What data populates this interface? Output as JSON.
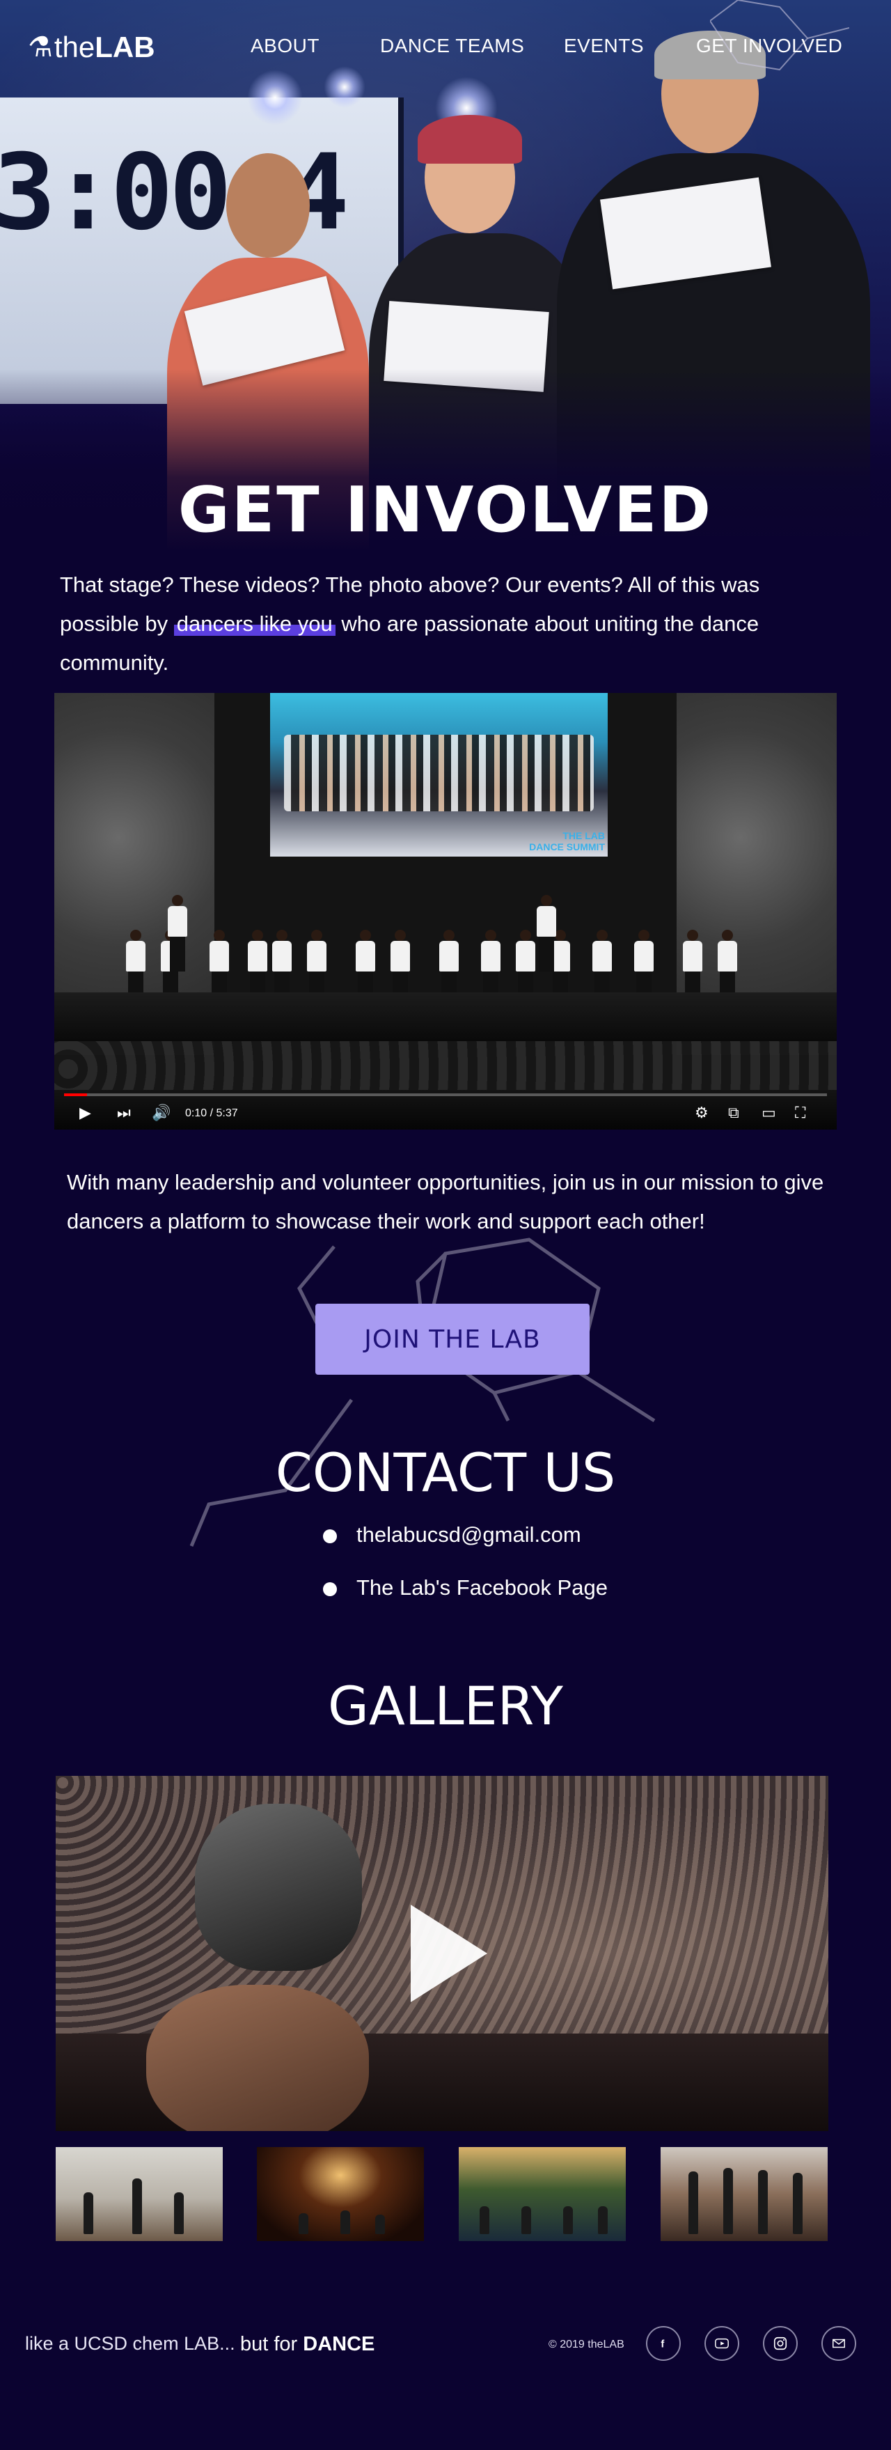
{
  "brand": {
    "the": "the",
    "lab": "LAB"
  },
  "nav": {
    "items": [
      {
        "label": "ABOUT"
      },
      {
        "label": "DANCE TEAMS"
      },
      {
        "label": "EVENTS"
      },
      {
        "label": "GET INVOLVED",
        "active": true
      }
    ]
  },
  "hero": {
    "clock_text": "3:00:4"
  },
  "get_involved": {
    "title": "GET INVOLVED",
    "intro_before": "That stage? These videos? The photo above? Our events? All of this was possible by ",
    "intro_highlight": "dancers like you",
    "intro_after": " who are passionate about uniting the dance community."
  },
  "video": {
    "time": "0:10 / 5:37",
    "progress": 0.03,
    "screen_caption_line1": "THE LAB",
    "screen_caption_line2": "DANCE SUMMIT"
  },
  "mission": "With many leadership and volunteer opportunities,  join us in our mission to give dancers a platform to showcase their work and support each other!",
  "join_button": "JOIN THE LAB",
  "contact": {
    "title": "CONTACT US",
    "items": [
      {
        "label": "thelabucsd@gmail.com"
      },
      {
        "label": "The Lab's Facebook Page"
      }
    ]
  },
  "gallery": {
    "title": "GALLERY"
  },
  "footer": {
    "tagline_a": "like a UCSD chem LAB...",
    "tagline_b_prefix": "but for ",
    "tagline_b_bold": "DANCE",
    "copyright": "© 2019 theLAB",
    "social": [
      "facebook-icon",
      "youtube-icon",
      "instagram-icon",
      "mail-icon"
    ]
  },
  "colors": {
    "background": "#0b0330",
    "accent": "#5b3fe0",
    "button_bg": "#a89bf2",
    "button_text": "#1f1278"
  }
}
